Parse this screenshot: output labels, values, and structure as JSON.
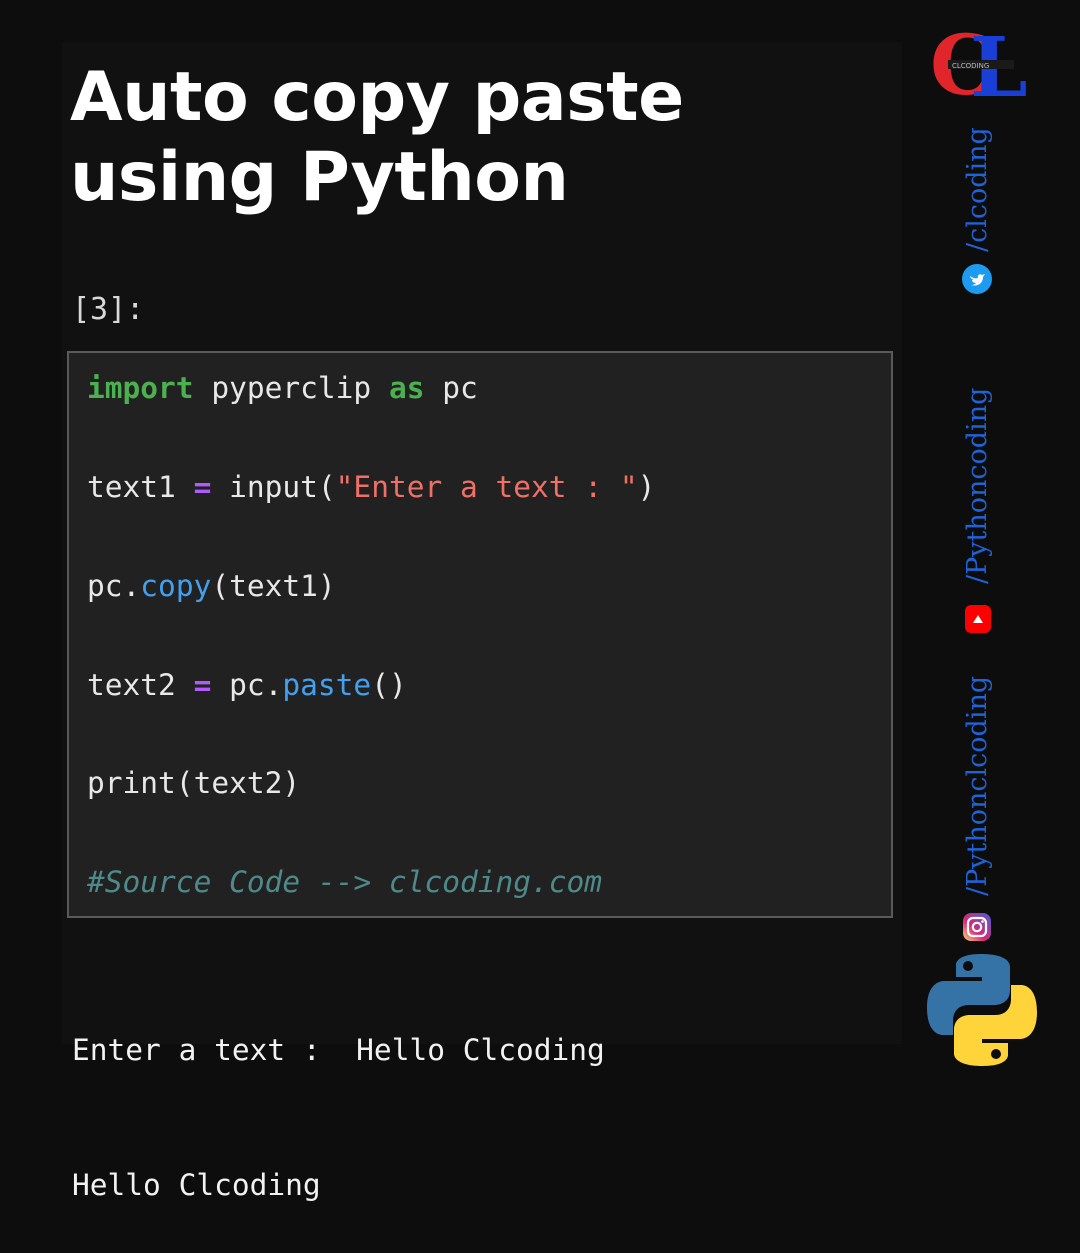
{
  "title": "Auto copy paste using Python",
  "cell_prompt": "[3]:",
  "code": {
    "line1": {
      "kw_import": "import",
      "module": " pyperclip ",
      "kw_as": "as",
      "alias": " pc"
    },
    "line2": {
      "var": "text1 ",
      "op": "=",
      "call": " input(",
      "str": "\"Enter a text : \"",
      "close": ")"
    },
    "line3": {
      "obj": "pc.",
      "method": "copy",
      "args": "(text1)"
    },
    "line4": {
      "var": "text2 ",
      "op": "=",
      "obj": " pc.",
      "method": "paste",
      "args": "()"
    },
    "line5": {
      "text": "print(text2)"
    },
    "comment": "#Source Code --> clcoding.com"
  },
  "output": {
    "line1": "Enter a text :  Hello Clcoding",
    "line2": "Hello Clcoding"
  },
  "brand": {
    "logo_text": "CL",
    "logo_subtext": "CLCODING",
    "twitter_handle": "/clcoding",
    "youtube_handle": "/Pythoncoding",
    "instagram_handle": "/Pythonclcoding"
  },
  "colors": {
    "background": "#0e0d0d",
    "keyword": "#4caf50",
    "operator": "#b15bff",
    "string": "#f07068",
    "method": "#42a0ef",
    "comment": "#4f8a8b",
    "handle_text": "#1f63d6"
  }
}
